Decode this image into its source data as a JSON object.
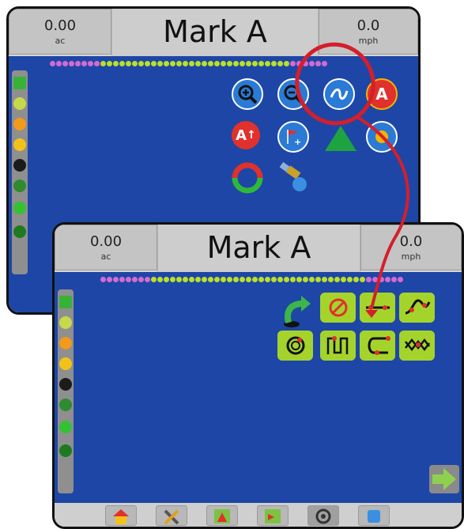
{
  "back_screen": {
    "area_value": "0.00",
    "area_unit": "ac",
    "title": "Mark A",
    "speed_value": "0.0",
    "speed_unit": "mph",
    "toolbar_icons": [
      "zoom-in-icon",
      "zoom-out-icon",
      "guidance-mode-icon",
      "mark-a-icon",
      "mark-a-plus-icon",
      "add-flag-icon",
      "green-triangle-icon",
      "compass-icon",
      "refresh-icon",
      "satellite-icon"
    ],
    "toolbar_letters": {
      "mark_a": "A",
      "mark_a_plus": "A"
    }
  },
  "front_screen": {
    "area_value": "0.00",
    "area_unit": "ac",
    "title": "Mark A",
    "speed_value": "0.0",
    "speed_unit": "mph",
    "guidance_modes": [
      "back-arrow-icon",
      "no-guidance-icon",
      "straight-ab-icon",
      "curved-ab-icon",
      "circle-pivot-icon",
      "adaptive-curve-icon",
      "last-pass-icon",
      "next-row-icon"
    ],
    "nav_tabs": [
      "home-icon",
      "tools-icon",
      "field-icon",
      "vehicle-view-icon",
      "guidance-icon",
      "data-icon"
    ],
    "next_arrow_icon": "next-arrow-icon"
  },
  "colors": {
    "field_blue": "#1e46a6",
    "header_gray": "#cdcdcd",
    "guidance_green": "#a4d42c",
    "callout_red": "#d41f2b"
  }
}
